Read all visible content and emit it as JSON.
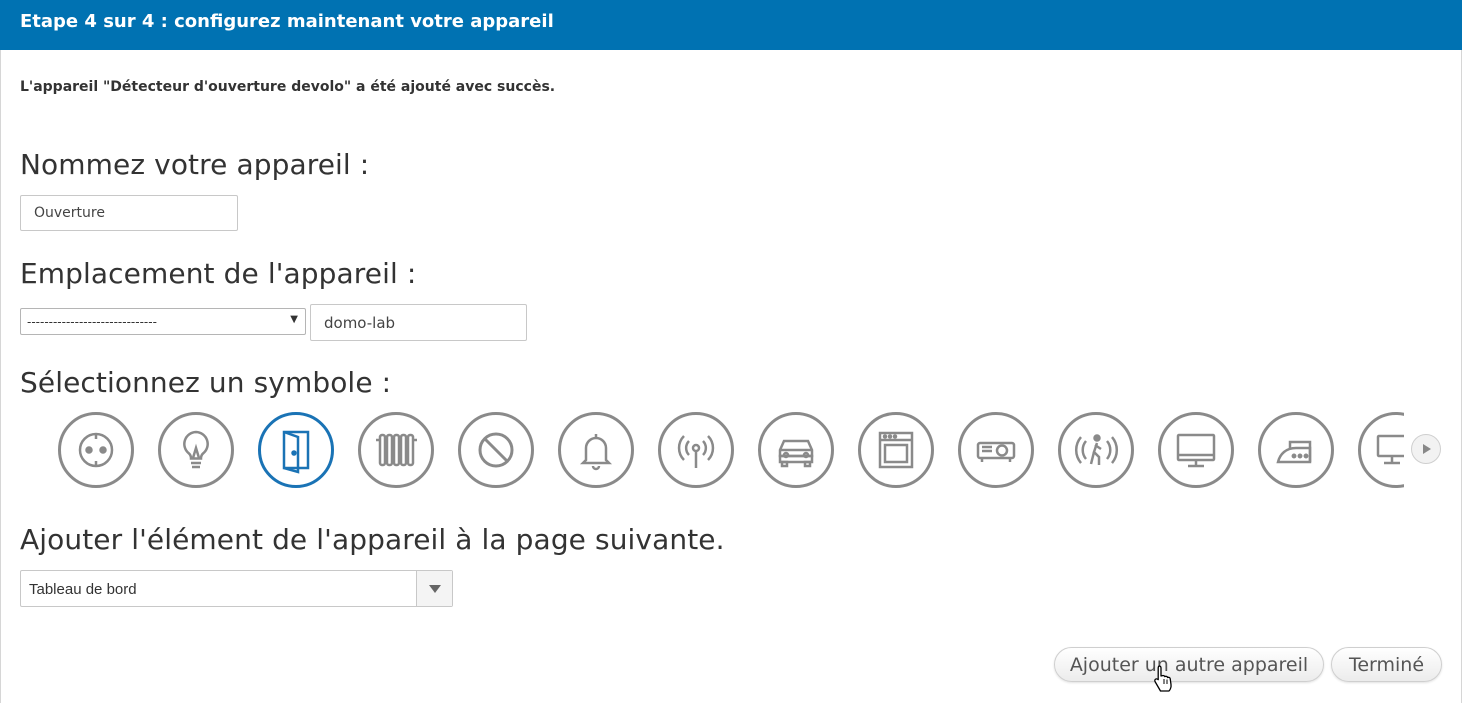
{
  "header": {
    "title": "Etape 4 sur 4 : configurez maintenant votre appareil"
  },
  "success_message": "L'appareil \"Détecteur d'ouverture devolo\" a été ajouté avec succès.",
  "name_section": {
    "label": "Nommez votre appareil :",
    "value": "Ouverture"
  },
  "location_section": {
    "label": "Emplacement de l'appareil :",
    "select_value": "------------------------------",
    "text_value": "domo-lab"
  },
  "symbol_section": {
    "label": "Sélectionnez un symbole :",
    "selected": "door-icon",
    "symbols": [
      "socket-icon",
      "bulb-icon",
      "door-icon",
      "radiator-icon",
      "forbidden-icon",
      "bell-icon",
      "antenna-icon",
      "car-icon",
      "oven-icon",
      "projector-icon",
      "motion-icon",
      "monitor-icon",
      "iron-icon",
      "computer-icon"
    ]
  },
  "page_section": {
    "label": "Ajouter l'élément de l'appareil à la page suivante.",
    "select_value": "Tableau de bord"
  },
  "buttons": {
    "add_another": "Ajouter un autre appareil",
    "done": "Terminé"
  },
  "colors": {
    "header_bg": "#0072b2",
    "selected_icon": "#1a73b5",
    "icon_gray": "#8a8a8a"
  }
}
